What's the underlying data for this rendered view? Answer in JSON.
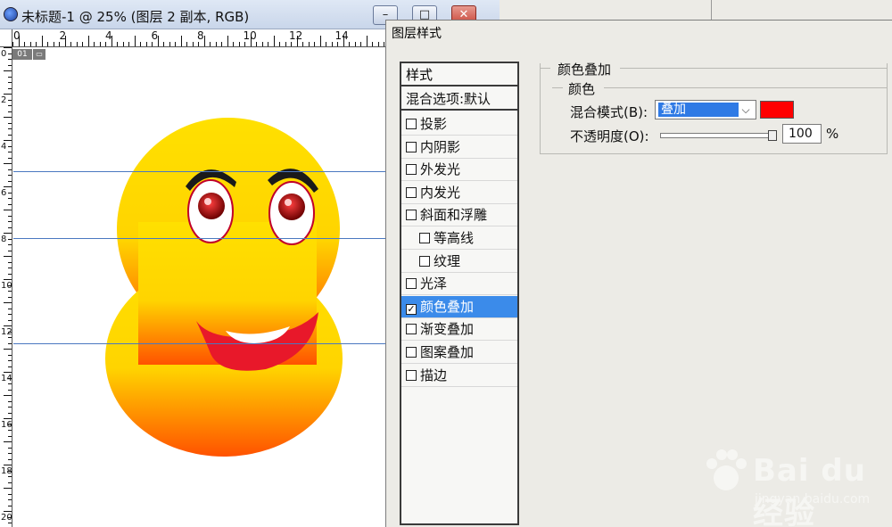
{
  "window": {
    "title": "未标题-1 @ 25% (图层 2 副本, RGB)",
    "min_glyph": "–",
    "max_glyph": "□",
    "close_glyph": "✕"
  },
  "ruler": {
    "h_labels": [
      "0",
      "2",
      "4",
      "6",
      "8",
      "10",
      "12",
      "14"
    ],
    "v_labels": [
      "0",
      "2",
      "4",
      "6",
      "8",
      "10",
      "12",
      "14",
      "16",
      "18",
      "20"
    ],
    "slice_badge": "01"
  },
  "dialog": {
    "title": "图层样式",
    "list_header": "样式",
    "blend_default": "混合选项:默认",
    "items": [
      {
        "label": "投影",
        "checked": false,
        "indent": false
      },
      {
        "label": "内阴影",
        "checked": false,
        "indent": false
      },
      {
        "label": "外发光",
        "checked": false,
        "indent": false
      },
      {
        "label": "内发光",
        "checked": false,
        "indent": false
      },
      {
        "label": "斜面和浮雕",
        "checked": false,
        "indent": false
      },
      {
        "label": "等高线",
        "checked": false,
        "indent": true
      },
      {
        "label": "纹理",
        "checked": false,
        "indent": true
      },
      {
        "label": "光泽",
        "checked": false,
        "indent": false
      },
      {
        "label": "颜色叠加",
        "checked": true,
        "indent": false,
        "selected": true
      },
      {
        "label": "渐变叠加",
        "checked": false,
        "indent": false
      },
      {
        "label": "图案叠加",
        "checked": false,
        "indent": false
      },
      {
        "label": "描边",
        "checked": false,
        "indent": false
      }
    ],
    "panel": {
      "section_title": "颜色叠加",
      "group_title": "颜色",
      "blend_mode_label": "混合模式(B):",
      "blend_mode_value": "叠加",
      "overlay_color": "#ff0000",
      "opacity_label": "不透明度(O):",
      "opacity_value": "100",
      "opacity_unit": "%",
      "opacity_level": 1.0
    }
  },
  "watermark": {
    "text": "Bai du 经验",
    "sub": "jingyan.baidu.com"
  },
  "colors": {
    "accent": "#3b8bea",
    "face_top": "#ffd800",
    "face_bottom": "#ff5a00",
    "guide": "#4a78c0"
  }
}
